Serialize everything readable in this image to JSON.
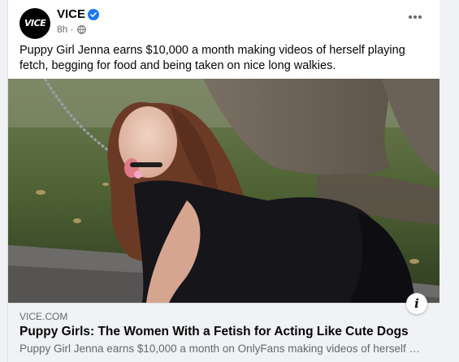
{
  "post": {
    "page_name": "VICE",
    "avatar_text": "VICE",
    "time": "8h",
    "separator": "·",
    "caption": "Puppy Girl Jenna earns $10,000 a month making videos of herself playing fetch, begging for food and being taken on nice long walkies.",
    "more_icon": "more-horizontal-icon",
    "privacy_icon": "globe-icon",
    "verified_icon": "verified-badge-icon",
    "colors": {
      "verified": "#1877f2",
      "background": "#f0f2f5",
      "secondary_text": "#65676b"
    }
  },
  "link_preview": {
    "domain": "VICE.COM",
    "title": "Puppy Girls: The Women With a Fetish for Acting Like Cute Dogs",
    "description": "Puppy Girl Jenna earns $10,000 a month on OnlyFans making videos of herself pl...",
    "info_label": "i"
  }
}
